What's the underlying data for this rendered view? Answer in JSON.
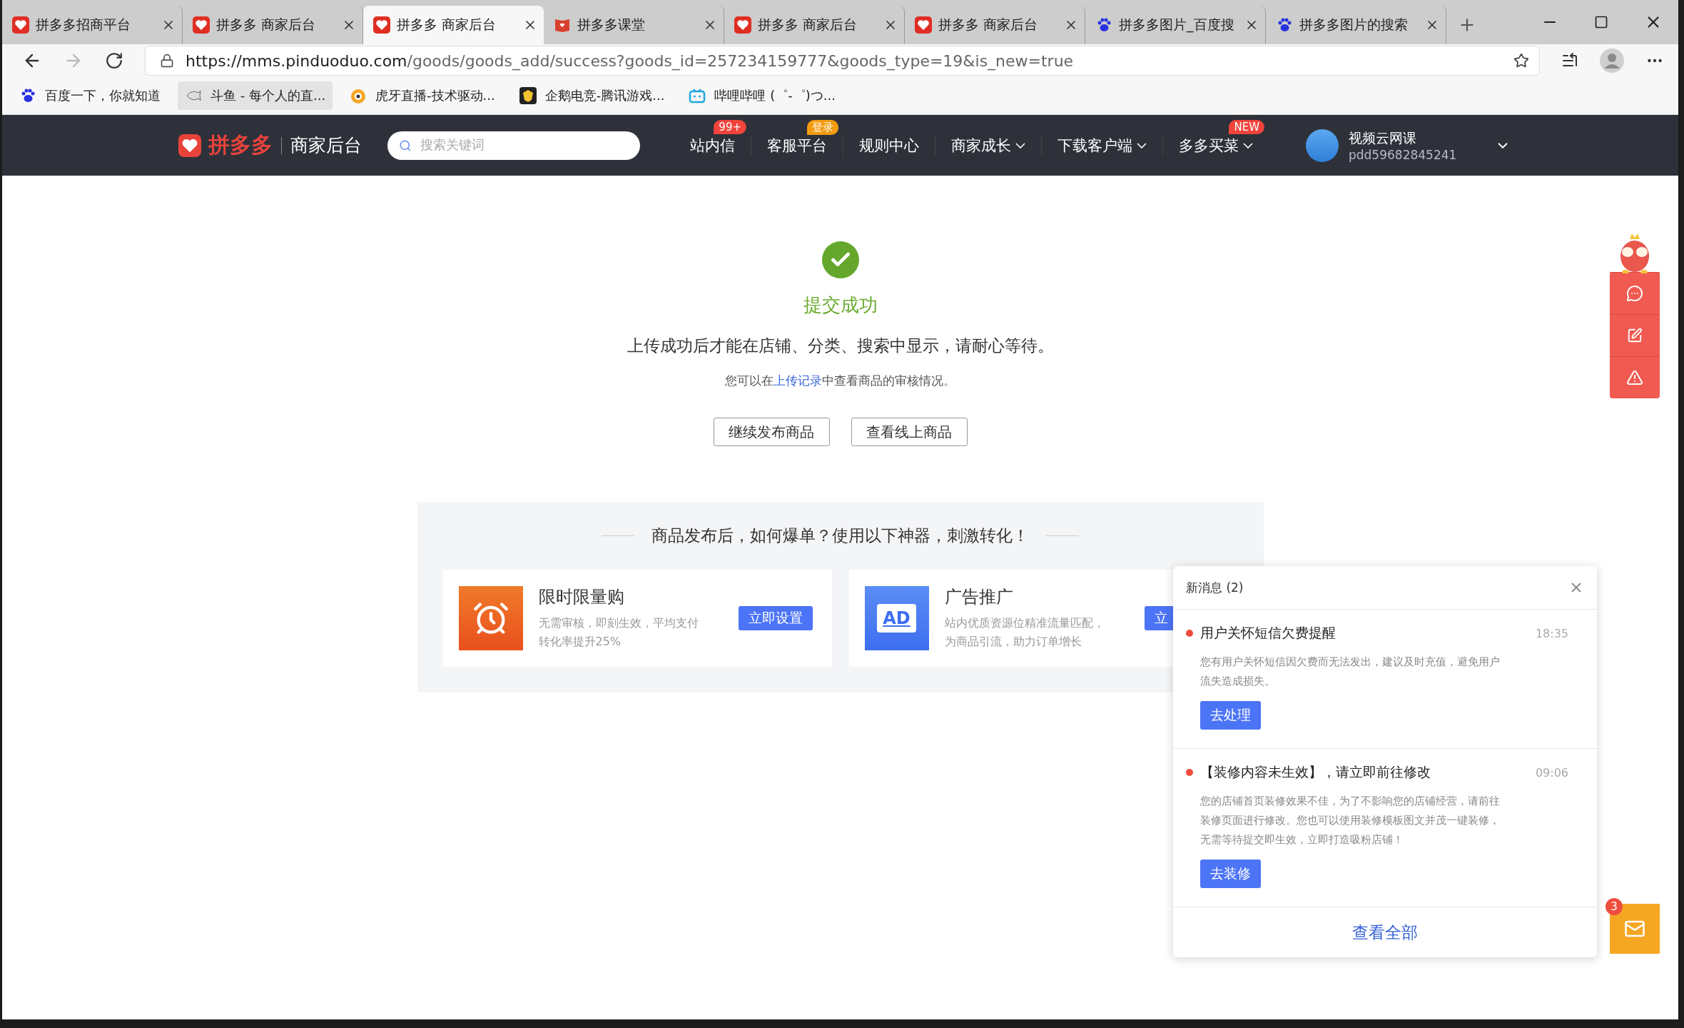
{
  "browser": {
    "tabs": [
      {
        "title": "拼多多招商平台",
        "kind": "pdd",
        "selected": false
      },
      {
        "title": "拼多多 商家后台",
        "kind": "pdd",
        "selected": false
      },
      {
        "title": "拼多多 商家后台",
        "kind": "pdd",
        "selected": true
      },
      {
        "title": "拼多多课堂",
        "kind": "book",
        "selected": false
      },
      {
        "title": "拼多多 商家后台",
        "kind": "pdd",
        "selected": false
      },
      {
        "title": "拼多多 商家后台",
        "kind": "pdd",
        "selected": false
      },
      {
        "title": "拼多多图片_百度搜",
        "kind": "paw",
        "selected": false
      },
      {
        "title": "拼多多图片的搜索",
        "kind": "paw",
        "selected": false
      }
    ],
    "url": "https://mms.pinduoduo.com/goods/goods_add/success?goods_id=257234159777&goods_type=19&is_new=true",
    "bookmarks": [
      {
        "title": "百度一下，你就知道",
        "kind": "paw",
        "selected": false
      },
      {
        "title": "斗鱼 - 每个人的直...",
        "kind": "fish",
        "selected": true
      },
      {
        "title": "虎牙直播-技术驱动...",
        "kind": "tiger",
        "selected": false
      },
      {
        "title": "企鹅电竞-腾讯游戏...",
        "kind": "crest",
        "selected": false
      },
      {
        "title": "哔哩哔哩 (゜-゜)つ...",
        "kind": "tv",
        "selected": false
      }
    ]
  },
  "header": {
    "logo": "拼多多",
    "product": "商家后台",
    "search": {
      "placeholder": "搜索关键词"
    },
    "nav": [
      {
        "label": "站内信",
        "badge": "99+",
        "color": "#f0443c",
        "dropdown": false
      },
      {
        "label": "客服平台",
        "badge": "登录",
        "color": "#f39c12",
        "dropdown": false
      },
      {
        "label": "规则中心",
        "dropdown": false
      },
      {
        "label": "商家成长",
        "dropdown": true
      },
      {
        "label": "下载客户端",
        "dropdown": true
      },
      {
        "label": "多多买菜",
        "badge": "NEW",
        "color": "#f0443c",
        "dropdown": true
      }
    ],
    "user": {
      "name": "视频云网课",
      "id": "pdd59682845241"
    }
  },
  "success": {
    "title": "提交成功",
    "message": "上传成功后才能在店铺、分类、搜索中显示，请耐心等待。",
    "note": {
      "before": "您可以在",
      "link": "上传记录",
      "after": "中查看商品的审核情况。"
    },
    "buttons": [
      "继续发布商品",
      "查看线上商品"
    ]
  },
  "promo": {
    "title": "商品发布后，如何爆单？使用以下神器，刺激转化！",
    "tools": [
      {
        "kind": "clock",
        "name": "限时限量购",
        "desc_lines": [
          "无需审核，即刻生效，平均支付",
          "转化率提升25%"
        ],
        "button": "立即设置"
      },
      {
        "kind": "ad",
        "icon_text": "AD",
        "name": "广告推广",
        "desc_lines": [
          "站内优质资源位精准流量匹配，",
          "为商品引流，助力订单增长"
        ],
        "button": "立"
      }
    ]
  },
  "notifications": {
    "title": "新消息 (2)",
    "items": [
      {
        "title": "用户关怀短信欠费提醒",
        "time": "18:35",
        "unread": true,
        "body_lines": [
          "您有用户关怀短信因欠费而无法发出，建议及时充值，避免用户",
          "流失造成损失。"
        ],
        "action": "去处理"
      },
      {
        "title": "【装修内容未生效】，请立即前往修改",
        "time": "09:06",
        "unread": true,
        "body_lines": [
          "您的店铺首页装修效果不佳，为了不影响您的店铺经营，请前往",
          "装修页面进行修改。您也可以使用装修模板图文并茂一键装修，",
          "无需等待提交即生效，立即打造吸粉店铺！"
        ],
        "action": "去装修"
      }
    ],
    "footer": "查看全部"
  },
  "mail": {
    "badge": "3"
  }
}
